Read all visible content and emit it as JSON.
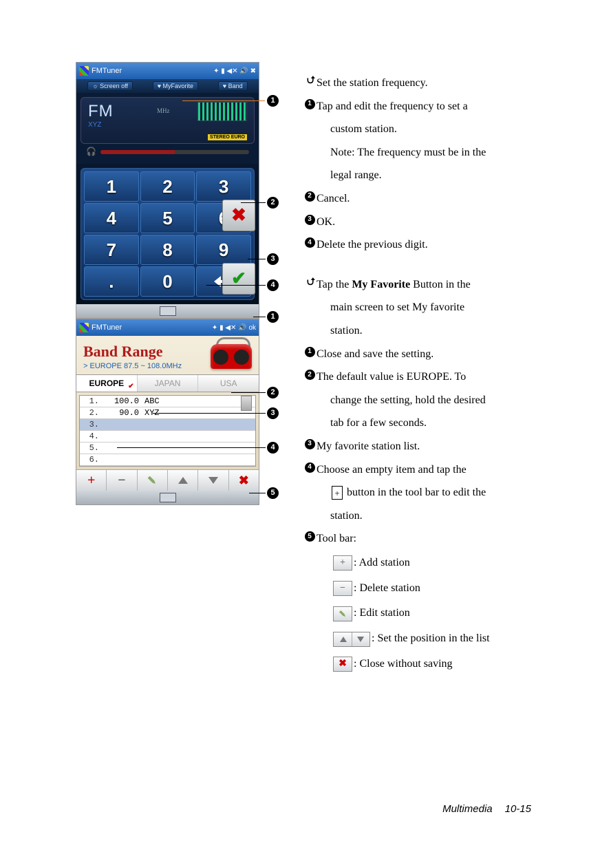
{
  "phone1": {
    "title": "FMTuner",
    "subbar": {
      "screenoff": "☼ Screen off",
      "myfav": "♥ MyFavorite",
      "band": "♥ Band"
    },
    "fm_label": "FM",
    "fm_sub": "XYZ",
    "mhz": "MHz",
    "stereo": "STEREO EURO",
    "keys": {
      "k1": "1",
      "k2": "2",
      "k3": "3",
      "k4": "4",
      "k5": "5",
      "k6": "6",
      "k7": "7",
      "k8": "8",
      "k9": "9",
      "k0": "0",
      "kdot": "."
    }
  },
  "phone2": {
    "title": "FMTuner",
    "heading": "Band Range",
    "subhead": "> EUROPE 87.5 ~ 108.0MHz",
    "tabs": {
      "europe": "EUROPE",
      "japan": "JAPAN",
      "usa": "USA"
    },
    "list": {
      "r1n": "1.",
      "r1f": "100.0",
      "r1name": "ABC",
      "r2n": "2.",
      "r2f": "90.0",
      "r2name": "XYZ",
      "r3n": "3.",
      "r4n": "4.",
      "r5n": "5.",
      "r6n": "6."
    }
  },
  "sec1": {
    "h": "Set the station frequency.",
    "i1a": "Tap and edit the frequency to set a",
    "i1b": "custom station.",
    "i1c": "Note: The frequency must be in the",
    "i1d": "legal range.",
    "i2": "Cancel.",
    "i3": "OK.",
    "i4": "Delete the previous digit."
  },
  "sec2": {
    "h_a": "Tap the ",
    "h_bold": "My Favorite",
    "h_b": " Button in the",
    "h_c": "main screen to set My favorite",
    "h_d": "station.",
    "i1": "Close and save the setting.",
    "i2a": "The default value is EUROPE. To",
    "i2b": "change the setting, hold the desired",
    "i2c": "tab for a few seconds.",
    "i3": "My favorite station list.",
    "i4a": "Choose an empty item and tap the",
    "i4b_a": " button in the tool bar to edit the",
    "i4c": "station.",
    "i5": "Tool bar:",
    "t_add": ": Add station",
    "t_del": ": Delete station",
    "t_edit": ": Edit station",
    "t_pos": ": Set the position in the list",
    "t_close": ": Close without saving"
  },
  "footer": {
    "section": "Multimedia",
    "page": "10-15"
  }
}
